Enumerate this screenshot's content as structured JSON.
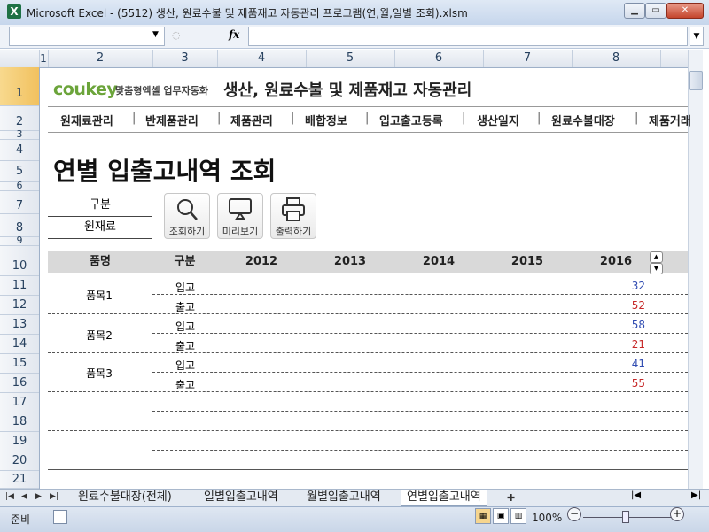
{
  "window": {
    "title": "Microsoft Excel - (5512) 생산, 원료수불 및 제품재고 자동관리 프로그램(연,월,일별 조회).xlsm",
    "app_icon": "X"
  },
  "formula_bar": {
    "fx_label": "fx",
    "name_box_value": "",
    "formula_value": ""
  },
  "columns": [
    "1",
    "2",
    "3",
    "4",
    "5",
    "6",
    "7",
    "8"
  ],
  "rows": [
    "1",
    "2",
    "3",
    "4",
    "5",
    "6",
    "7",
    "8",
    "9",
    "10",
    "11",
    "12",
    "13",
    "14",
    "15",
    "16",
    "17",
    "18",
    "19",
    "20",
    "21"
  ],
  "sheet": {
    "logo": "coukey",
    "logo_tagline": "맞춤형엑셀 업무자동화",
    "app_title": "생산, 원료수불 및 제품재고 자동관리",
    "menu": [
      "원재료관리",
      "반제품관리",
      "제품관리",
      "배합정보",
      "입고출고등록",
      "생산일지",
      "원료수불대장",
      "제품거래"
    ],
    "page_title": "연별 입출고내역 조회",
    "filter": {
      "header": "구분",
      "value": "원재료"
    },
    "buttons": {
      "search": "조회하기",
      "preview": "미리보기",
      "print": "출력하기"
    },
    "table": {
      "headers": [
        "품명",
        "구분",
        "2012",
        "2013",
        "2014",
        "2015",
        "2016"
      ],
      "rows": [
        {
          "product": "품목1",
          "in_label": "입고",
          "in_value": "32",
          "out_label": "출고",
          "out_value": "52"
        },
        {
          "product": "품목2",
          "in_label": "입고",
          "in_value": "58",
          "out_label": "출고",
          "out_value": "21"
        },
        {
          "product": "품목3",
          "in_label": "입고",
          "in_value": "41",
          "out_label": "출고",
          "out_value": "55"
        }
      ]
    }
  },
  "sheet_tabs": [
    "원료수불대장(전체)",
    "일별입출고내역",
    "월별입출고내역",
    "연별입출고내역"
  ],
  "active_tab": "연별입출고내역",
  "status": {
    "ready": "준비",
    "zoom": "100%"
  },
  "colors": {
    "accent_in": "#2f4bb1",
    "accent_out": "#c62828",
    "logo_green": "#6ba43a"
  }
}
